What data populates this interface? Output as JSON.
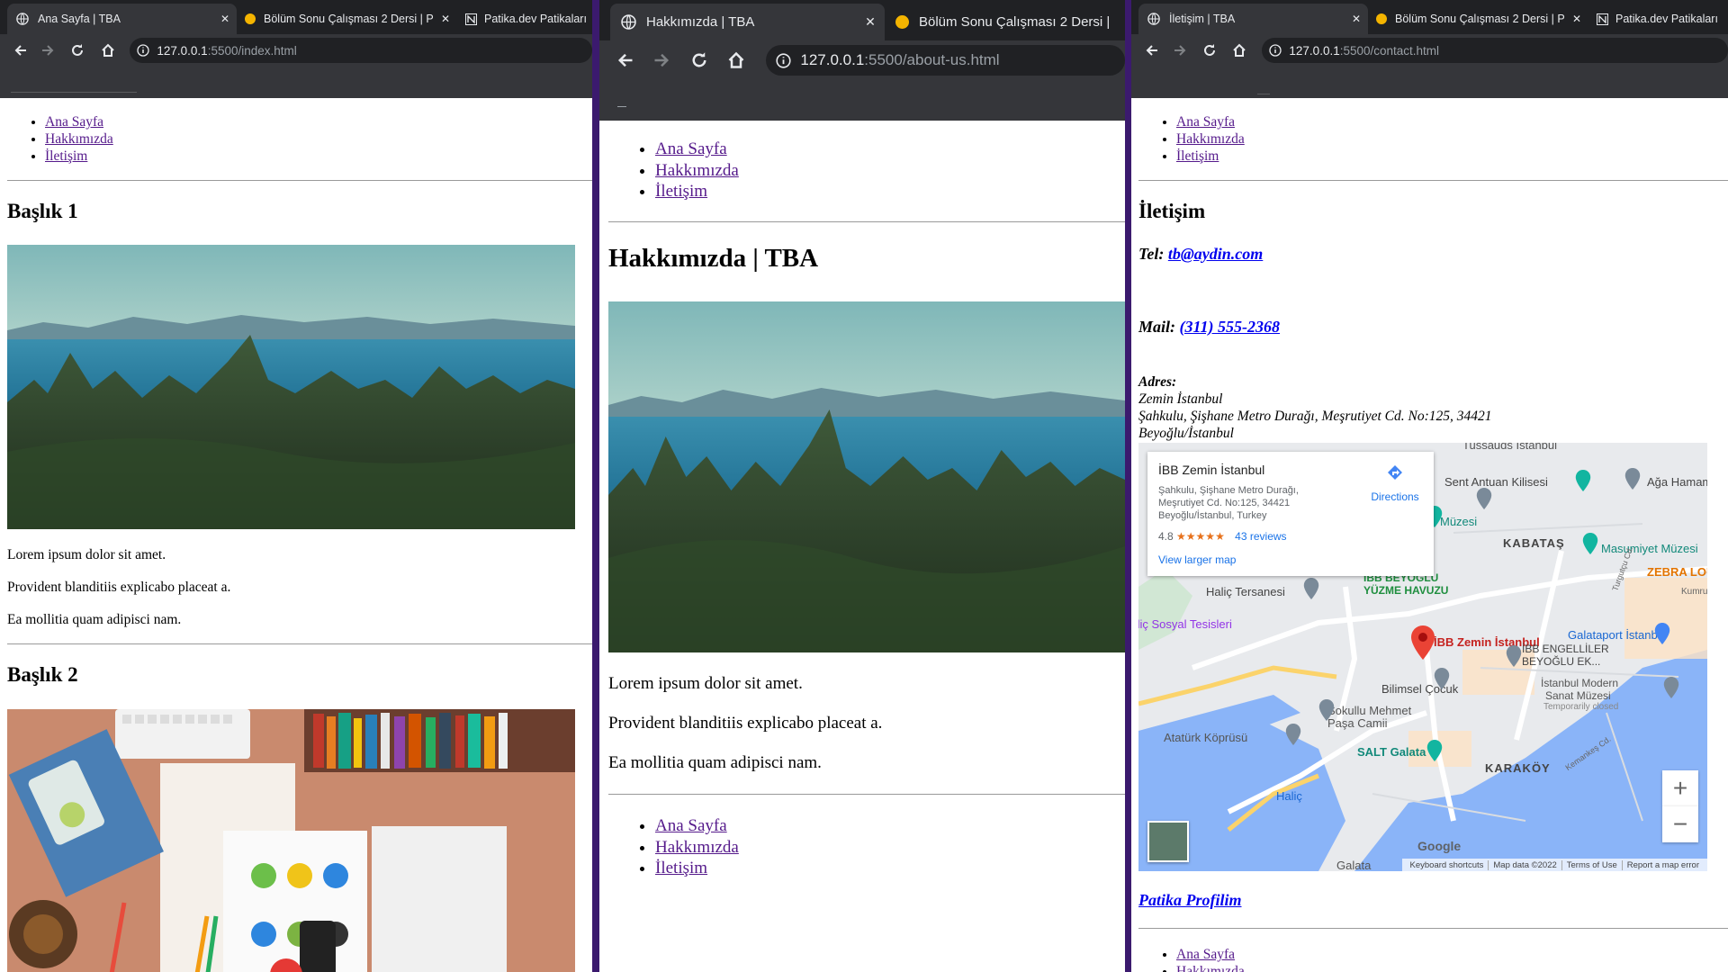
{
  "windows": [
    {
      "tabs": [
        {
          "title": "Ana Sayfa | TBA",
          "active": true,
          "favicon": "globe-icon"
        },
        {
          "title": "Bölüm Sonu Çalışması 2 Dersi | P",
          "active": false,
          "favicon": "dot-icon"
        },
        {
          "title": "Patika.dev Patikaları",
          "active": false,
          "favicon": "patika-icon"
        }
      ],
      "close_glyph": "✕",
      "url": {
        "host": "127.0.0.1",
        "path": ":5500/index.html"
      },
      "nav": {
        "links": [
          "Ana Sayfa",
          "Hakkımızda",
          "İletişim"
        ]
      },
      "sections": [
        {
          "heading": "Başlık 1",
          "paragraphs": [
            "Lorem ipsum dolor sit amet.",
            "Provident blanditiis explicabo placeat a.",
            "Ea mollitia quam adipisci nam."
          ]
        },
        {
          "heading": "Başlık 2"
        }
      ]
    },
    {
      "tabs": [
        {
          "title": "Hakkımızda | TBA",
          "active": true,
          "favicon": "globe-icon"
        },
        {
          "title": "Bölüm Sonu Çalışması 2 Dersi |",
          "active": false,
          "favicon": "dot-icon"
        }
      ],
      "close_glyph": "✕",
      "url": {
        "host": "127.0.0.1",
        "path": ":5500/about-us.html"
      },
      "nav": {
        "links": [
          "Ana Sayfa",
          "Hakkımızda",
          "İletişim"
        ]
      },
      "heading": "Hakkımızda | TBA",
      "paragraphs": [
        "Lorem ipsum dolor sit amet.",
        "Provident blanditiis explicabo placeat a.",
        "Ea mollitia quam adipisci nam."
      ],
      "footer_nav": {
        "links": [
          "Ana Sayfa",
          "Hakkımızda",
          "İletişim"
        ]
      }
    },
    {
      "tabs": [
        {
          "title": "İletişim | TBA",
          "active": true,
          "favicon": "globe-icon"
        },
        {
          "title": "Bölüm Sonu Çalışması 2 Dersi | P",
          "active": false,
          "favicon": "dot-icon"
        },
        {
          "title": "Patika.dev Patikaları",
          "active": false,
          "favicon": "patika-icon"
        }
      ],
      "close_glyph": "✕",
      "url": {
        "host": "127.0.0.1",
        "path": ":5500/contact.html"
      },
      "nav": {
        "links": [
          "Ana Sayfa",
          "Hakkımızda",
          "İletişim"
        ]
      },
      "heading": "İletişim",
      "tel_label": "Tel:",
      "tel_value": "tb@aydin.com",
      "mail_label": "Mail:",
      "mail_value": "(311) 555-2368",
      "address_label": "Adres:",
      "address_lines": [
        "Zemin İstanbul",
        "Şahkulu, Şişhane Metro Durağı, Meşrutiyet Cd. No:125, 34421",
        "Beyoğlu/İstanbul"
      ],
      "map": {
        "card_title": "İBB Zemin İstanbul",
        "card_address": [
          "Şahkulu, Şişhane Metro Durağı,",
          "Meşrutiyet Cd. No:125, 34421",
          "Beyoğlu/İstanbul, Turkey"
        ],
        "rating": "4.8",
        "stars": "★★★★★",
        "reviews": "43 reviews",
        "directions": "Directions",
        "larger_map": "View larger map",
        "labels": {
          "tussauds": "Tussauds İstanbul",
          "antuan": "Sent Antuan Kilisesi",
          "aga_hamam": "Ağa Hamam",
          "muzesi": "Müzesi",
          "kabatas": "KABATAŞ",
          "masumiyet": "Masumiyet Müzesi",
          "zebra": "ZEBRA LOUNGE",
          "yuzme1": "İBB BEYOĞLU",
          "yuzme2": "YÜZME HAVUZU",
          "halic_tersanesi": "Haliç Tersanesi",
          "sosyal": "Haliç Sosyal Tesisleri",
          "zemin": "İBB Zemin İstanbul",
          "galataport": "Galataport İstanbul",
          "engelliler1": "İBB ENGELLİLER",
          "engelliler2": "BEYOĞLU EK...",
          "bilimsel": "Bilimsel Çocuk",
          "modern1": "İstanbul Modern",
          "modern2": "Sanat Müzesi",
          "modern3": "Temporarily closed",
          "sokullu1": "Sokullu Mehmet",
          "sokullu2": "Paşa Camii",
          "ataturk_koprusu": "Atatürk Köprüsü",
          "salt": "SALT Galata",
          "karakoy": "KARAKÖY",
          "halic_m": "Haliç",
          "galata": "Galata",
          "kurun": "Kumru",
          "tophane": "Turgutçu Cd.",
          "kemankes": "Kemankeş Cd."
        },
        "google": "Google",
        "attribution": [
          "Keyboard shortcuts",
          "Map data ©2022",
          "Terms of Use",
          "Report a map error"
        ],
        "zoom_in": "+",
        "zoom_out": "−"
      },
      "profile_link": "Patika Profilim",
      "footer_nav": {
        "links": [
          "Ana Sayfa",
          "Hakkımızda"
        ]
      }
    }
  ],
  "colors": {
    "tab_bar": "#202124",
    "toolbar": "#35363a",
    "link_visited": "#551a8b",
    "link": "#0000ee",
    "divider": "#3b1a6e",
    "dot": "#f4b400"
  }
}
